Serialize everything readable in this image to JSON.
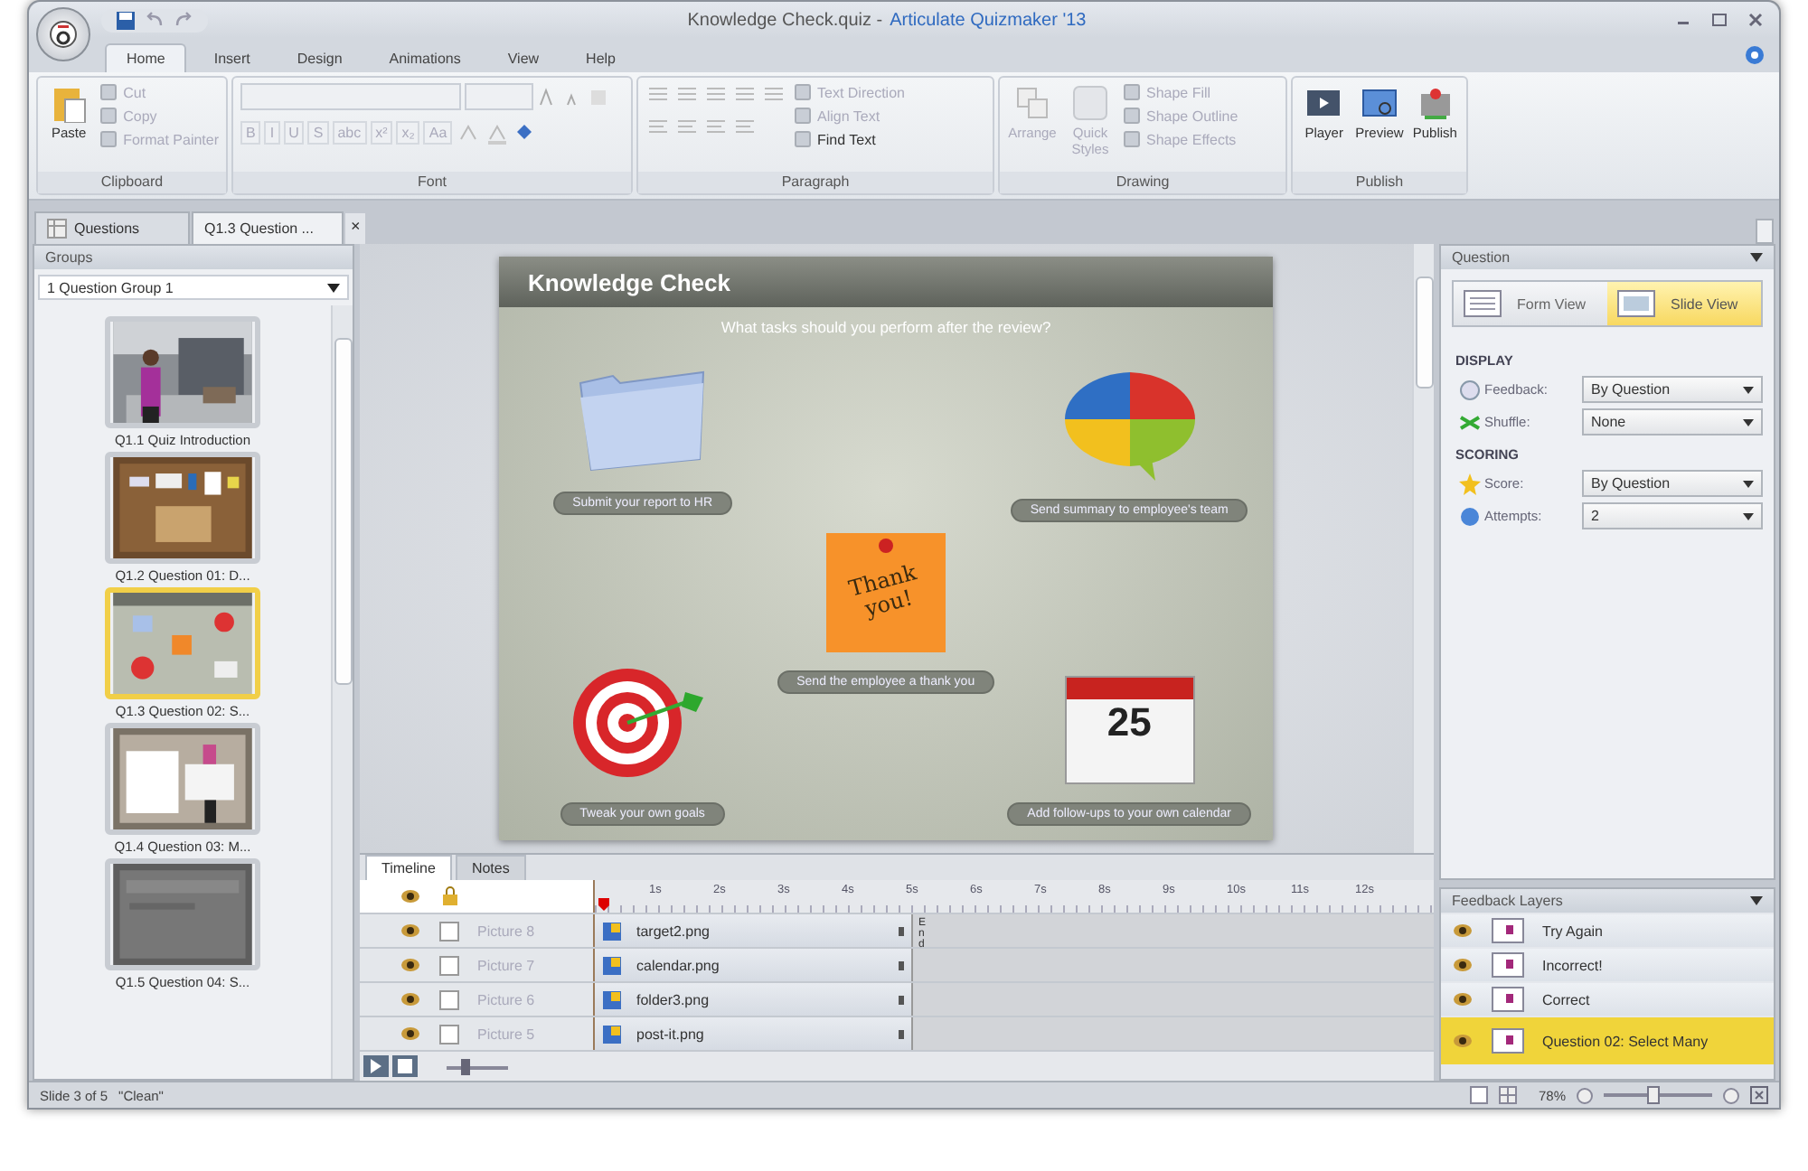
{
  "window": {
    "title": "Knowledge Check.quiz -",
    "app": "Articulate Quizmaker '13"
  },
  "ribbon_tabs": [
    {
      "label": "Home",
      "selected": true
    },
    {
      "label": "Insert",
      "selected": false
    },
    {
      "label": "Design",
      "selected": false
    },
    {
      "label": "Animations",
      "selected": false
    },
    {
      "label": "View",
      "selected": false
    },
    {
      "label": "Help",
      "selected": false
    }
  ],
  "ribbon_groups": [
    {
      "title": "Clipboard",
      "kind": "clipboard",
      "items": [
        {
          "label": "Paste",
          "kind": "large",
          "disabled": false
        },
        {
          "label": "Cut",
          "kind": "small",
          "disabled": true
        },
        {
          "label": "Copy",
          "kind": "small",
          "disabled": true
        },
        {
          "label": "Format Painter",
          "kind": "small",
          "disabled": true
        }
      ]
    },
    {
      "title": "Font",
      "kind": "font",
      "items": [
        {
          "label": "B",
          "disabled": true
        },
        {
          "label": "I",
          "disabled": true
        },
        {
          "label": "U",
          "disabled": true
        },
        {
          "label": "S",
          "disabled": true
        },
        {
          "label": "abc",
          "disabled": true
        },
        {
          "label": "x²",
          "disabled": true
        },
        {
          "label": "x₂",
          "disabled": true
        },
        {
          "label": "Aa",
          "disabled": true
        }
      ]
    },
    {
      "title": "Paragraph",
      "kind": "paragraph",
      "items": [
        {
          "label": "Text Direction",
          "disabled": true
        },
        {
          "label": "Align Text",
          "disabled": true
        },
        {
          "label": "Find Text",
          "disabled": false
        }
      ]
    },
    {
      "title": "Drawing",
      "kind": "drawing",
      "items": [
        {
          "label": "Arrange",
          "kind": "large",
          "disabled": true
        },
        {
          "label": "Quick Styles",
          "kind": "large",
          "disabled": true
        },
        {
          "label": "Shape Fill",
          "kind": "small",
          "disabled": true
        },
        {
          "label": "Shape Outline",
          "kind": "small",
          "disabled": true
        },
        {
          "label": "Shape Effects",
          "kind": "small",
          "disabled": true
        }
      ]
    },
    {
      "title": "Publish",
      "kind": "publish",
      "items": [
        {
          "label": "Player",
          "kind": "large",
          "disabled": false
        },
        {
          "label": "Preview",
          "kind": "large",
          "disabled": false
        },
        {
          "label": "Publish",
          "kind": "large",
          "disabled": false
        }
      ]
    }
  ],
  "doc_tabs": [
    {
      "label": "Questions",
      "selected": false
    },
    {
      "label": "Q1.3 Question ...",
      "selected": true,
      "close": "×"
    }
  ],
  "groups_panel": {
    "title": "Groups",
    "group": "1 Question Group 1"
  },
  "slides": [
    {
      "label": "Q1.1 Quiz Introduction",
      "selected": false
    },
    {
      "label": "Q1.2 Question 01: D...",
      "selected": false
    },
    {
      "label": "Q1.3 Question 02: S...",
      "selected": true
    },
    {
      "label": "Q1.4 Question 03: M...",
      "selected": false
    },
    {
      "label": "Q1.5 Question 04: S...",
      "selected": false
    }
  ],
  "slide": {
    "title": "Knowledge Check",
    "question": "What tasks should you perform after the review?",
    "columns": [
      [
        {
          "label": "Submit your report to HR",
          "kind": "folder"
        },
        {
          "label": "Tweak your own goals",
          "kind": "target"
        }
      ],
      [
        {
          "label": "Send the employee a thank you",
          "kind": "note",
          "art_text": "Thank you!"
        }
      ],
      [
        {
          "label": "Send summary to employee's team",
          "kind": "puzzle"
        },
        {
          "label": "Add follow-ups to your own calendar",
          "kind": "calendar",
          "art_text": "25"
        }
      ]
    ]
  },
  "timeline": {
    "tabs": [
      {
        "label": "Timeline",
        "selected": true
      },
      {
        "label": "Notes",
        "selected": false
      }
    ],
    "ticks": [
      "1s",
      "2s",
      "3s",
      "4s",
      "5s",
      "6s",
      "7s",
      "8s",
      "9s",
      "10s",
      "11s",
      "12s"
    ],
    "end_label": "End",
    "rows": [
      {
        "name": "Picture 8",
        "file": "target2.png",
        "checked": false
      },
      {
        "name": "Picture 7",
        "file": "calendar.png",
        "checked": false
      },
      {
        "name": "Picture 6",
        "file": "folder3.png",
        "checked": false
      },
      {
        "name": "Picture 5",
        "file": "post-it.png",
        "checked": false
      }
    ],
    "level": 0.3
  },
  "question_panel": {
    "title": "Question",
    "views": [
      {
        "label": "Form View",
        "selected": false
      },
      {
        "label": "Slide View",
        "selected": true
      }
    ],
    "sections": [
      {
        "title": "DISPLAY",
        "fields": [
          {
            "label": "Feedback:",
            "value": "By Question"
          },
          {
            "label": "Shuffle:",
            "value": "None"
          }
        ]
      },
      {
        "title": "SCORING",
        "fields": [
          {
            "label": "Score:",
            "value": "By Question"
          },
          {
            "label": "Attempts:",
            "value": "2"
          }
        ]
      }
    ]
  },
  "feedback_layers": {
    "title": "Feedback Layers",
    "layers": [
      {
        "label": "Try Again",
        "selected": false
      },
      {
        "label": "Incorrect!",
        "selected": false
      },
      {
        "label": "Correct",
        "selected": false
      },
      {
        "label": "Question 02: Select Many",
        "selected": true
      }
    ]
  },
  "status_bar": {
    "slide": "Slide 3 of 5",
    "theme": "\"Clean\"",
    "zoom": "78%",
    "level": 0.45
  }
}
